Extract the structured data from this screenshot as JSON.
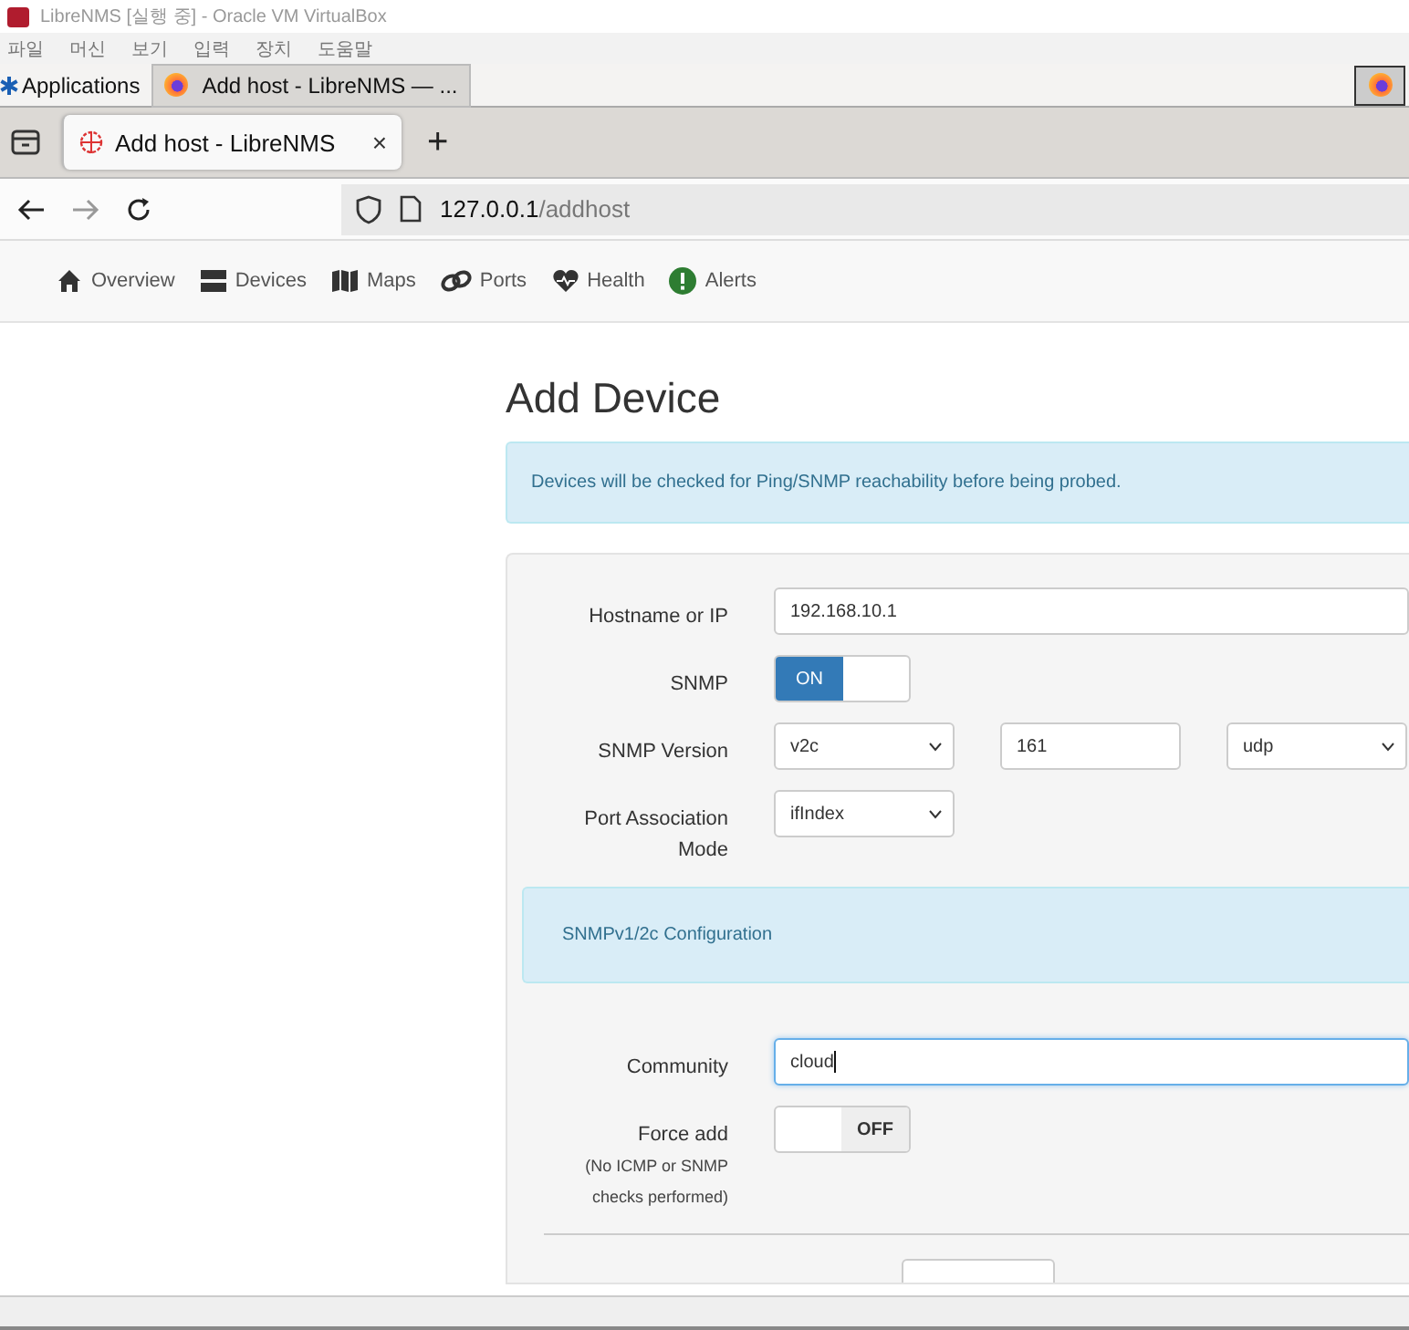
{
  "vm_window": {
    "title": "LibreNMS [실행 중] - Oracle VM VirtualBox",
    "menu": [
      "파일",
      "머신",
      "보기",
      "입력",
      "장치",
      "도움말"
    ]
  },
  "taskbar": {
    "applications": "Applications",
    "window_button": "Add host - LibreNMS — ..."
  },
  "browser": {
    "tab": {
      "title": "Add host - LibreNMS",
      "close": "×",
      "selected": true
    },
    "new_tab": "+",
    "url_host": "127.0.0.1",
    "url_path": "/addhost"
  },
  "nav": [
    {
      "kind": "home",
      "label": "Overview"
    },
    {
      "kind": "server",
      "label": "Devices"
    },
    {
      "kind": "map",
      "label": "Maps"
    },
    {
      "kind": "link",
      "label": "Ports"
    },
    {
      "kind": "heart",
      "label": "Health"
    },
    {
      "kind": "alert",
      "label": "Alerts"
    }
  ],
  "page": {
    "title": "Add Device",
    "info": "Devices will be checked for Ping/SNMP reachability before being probed."
  },
  "form": {
    "rows": [
      {
        "kind": "text",
        "label": "Hostname or IP",
        "value": "192.168.10.1"
      },
      {
        "kind": "toggle",
        "label": "SNMP",
        "on": true,
        "text": "ON"
      },
      {
        "kind": "version",
        "label": "SNMP Version",
        "version": "v2c",
        "port": "161",
        "transport": "udp"
      },
      {
        "kind": "select",
        "label": "Port Association Mode",
        "value": "ifIndex"
      }
    ],
    "section": "SNMPv1/2c Configuration",
    "rows2": [
      {
        "kind": "text",
        "label": "Community",
        "value": "cloud",
        "focused": true
      },
      {
        "kind": "toggle",
        "label": "Force add",
        "note": "(No ICMP or SNMP checks performed)",
        "on": false,
        "text": "OFF"
      }
    ]
  }
}
